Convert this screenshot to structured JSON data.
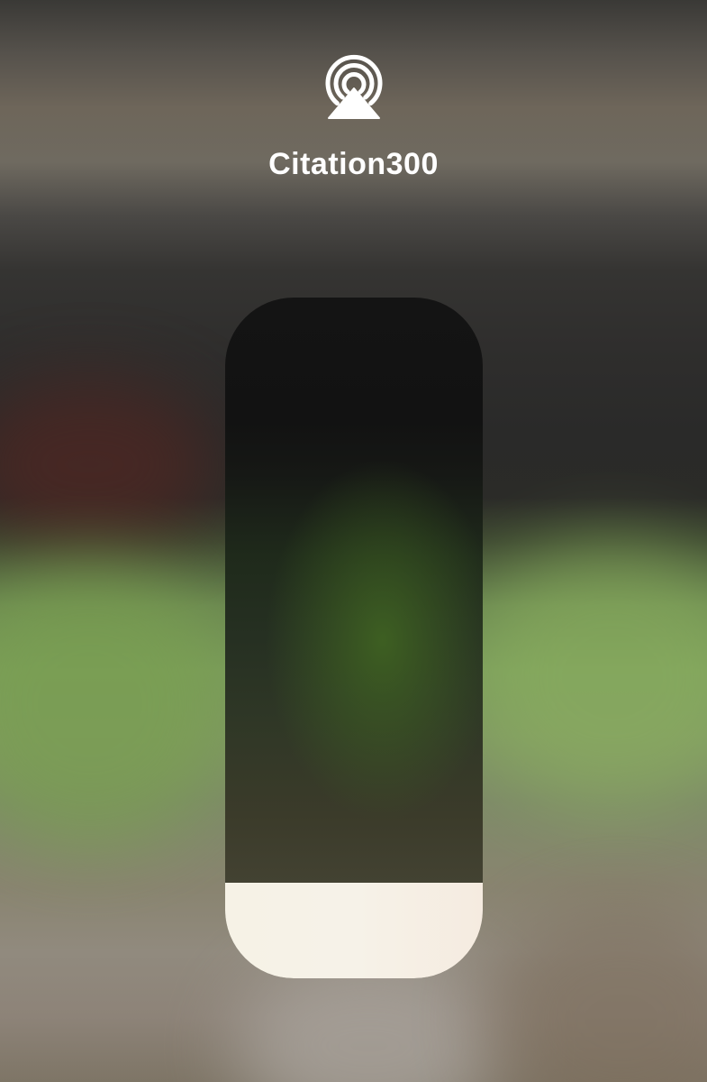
{
  "airplay": {
    "icon": "airplay-audio-icon",
    "device_name": "Citation300"
  },
  "volume": {
    "level": 0.14
  },
  "colors": {
    "text": "#ffffff",
    "slider_track": "#141414",
    "slider_fill": "#f6f2e8"
  }
}
